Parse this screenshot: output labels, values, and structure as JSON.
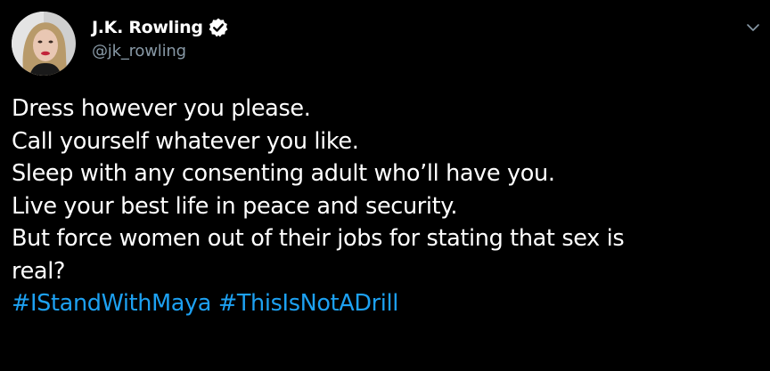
{
  "author": {
    "display_name": "J.K. Rowling",
    "handle": "@jk_rowling",
    "verified": true,
    "avatar_icon": "profile-photo"
  },
  "tweet": {
    "lines": [
      "Dress however you please.",
      "Call yourself whatever you like.",
      "Sleep with any consenting adult who’ll have you.",
      "Live your best life in peace and security.",
      "But force women out of their jobs for stating that sex is",
      "real?"
    ],
    "hashtags": [
      "#IStandWithMaya",
      "#ThisIsNotADrill"
    ]
  },
  "menu_icon": "chevron-down-icon",
  "colors": {
    "background": "#000000",
    "text": "#ffffff",
    "secondary_text": "#8899a6",
    "link": "#1da1f2"
  }
}
